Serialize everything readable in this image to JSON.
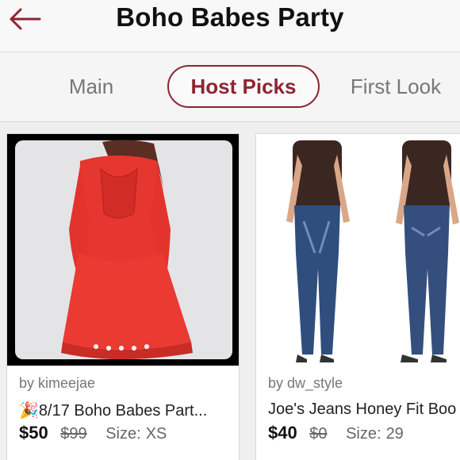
{
  "header": {
    "title": "Boho Babes Party",
    "back_icon": "back-arrow-icon",
    "accent": "#8f2432"
  },
  "tabs": [
    {
      "label": "Main"
    },
    {
      "label": "Host Picks",
      "selected": true
    },
    {
      "label": "First Look"
    }
  ],
  "listings": [
    {
      "seller": "by kimeejae",
      "title_emoji": "🎉",
      "title": "8/17 Boho Babes Part...",
      "price": "$50",
      "original_price": "$99",
      "size_label": "Size:",
      "size": "XS",
      "image": "red-lace-dress-photo"
    },
    {
      "seller": "by dw_style",
      "title": "Joe's Jeans Honey Fit Boo",
      "price": "$40",
      "original_price": "$0",
      "size_label": "Size:",
      "size": "29",
      "image": "jeans-model-photo"
    }
  ]
}
